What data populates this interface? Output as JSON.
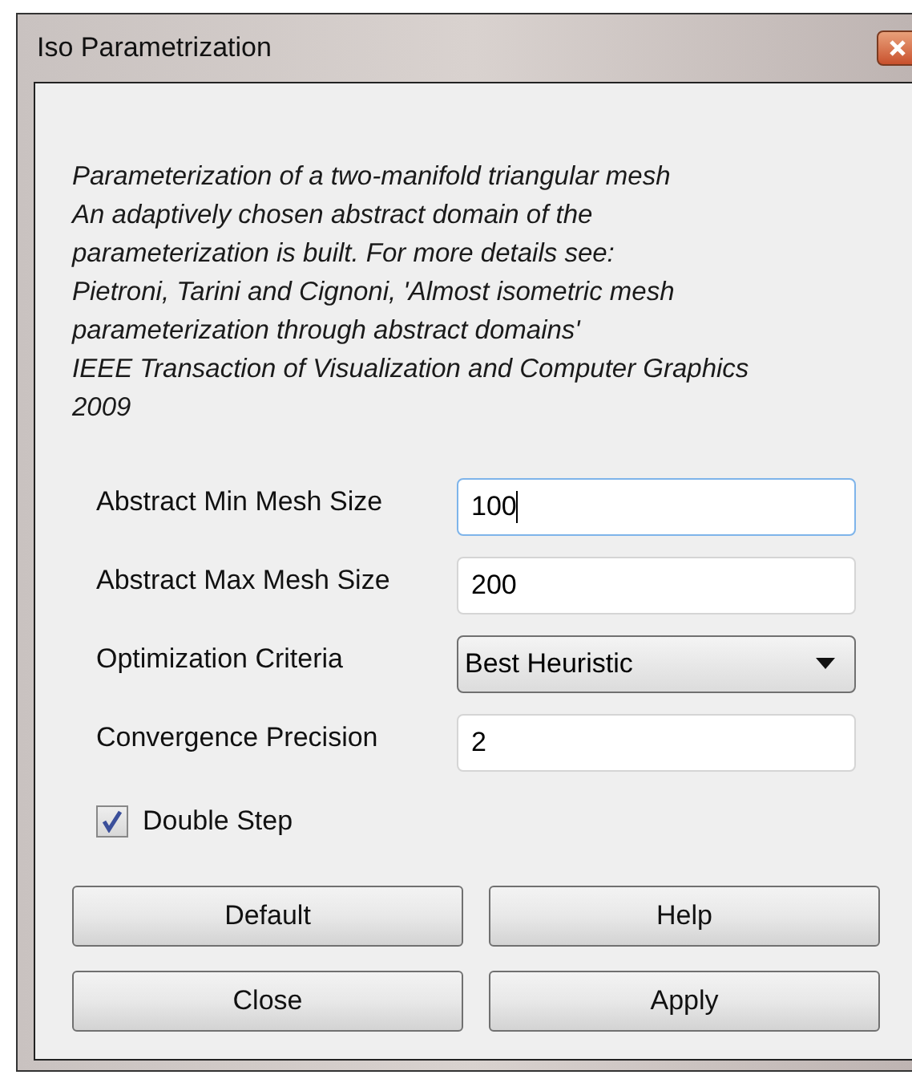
{
  "window": {
    "title": "Iso Parametrization"
  },
  "description": [
    "Parameterization of a two-manifold triangular mesh",
    "An adaptively chosen abstract domain of the",
    "parameterization is built. For more details see:",
    "Pietroni, Tarini and Cignoni, 'Almost isometric mesh",
    "parameterization through abstract domains'",
    "IEEE Transaction of Visualization and Computer Graphics",
    "2009"
  ],
  "fields": [
    {
      "kind": "text",
      "label": "Abstract Min Mesh Size",
      "value": "100",
      "focused": true
    },
    {
      "kind": "text",
      "label": "Abstract Max Mesh Size",
      "value": "200",
      "focused": false
    },
    {
      "kind": "dropdown",
      "label": "Optimization Criteria",
      "value": "Best Heuristic"
    },
    {
      "kind": "text",
      "label": "Convergence Precision",
      "value": "2",
      "focused": false
    }
  ],
  "checkbox": {
    "label": "Double Step",
    "checked": true
  },
  "buttons": [
    "Default",
    "Help",
    "Close",
    "Apply"
  ]
}
